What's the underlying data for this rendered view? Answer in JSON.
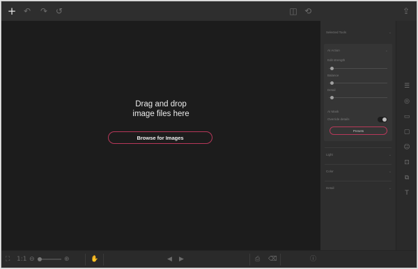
{
  "toolbar": {
    "left_icons": [
      "plus-icon",
      "undo-icon",
      "redo-icon",
      "reset-icon"
    ],
    "center_icons": [
      "compare-icon",
      "history-icon"
    ],
    "right_icons": [
      "share-icon"
    ],
    "glyphs": {
      "plus": "+",
      "undo": "↶",
      "redo": "↷",
      "reset": "↺",
      "compare": "◫",
      "history": "⟲",
      "share": "⇪"
    }
  },
  "canvas": {
    "drop_line1": "Drag and drop",
    "drop_line2": "image files here",
    "browse_label": "Browse for Images",
    "accent": "#b8385a"
  },
  "panel": {
    "section_title": "Selected Tools",
    "ai_action_label": "AI Action",
    "slider1_label": "Edit strength",
    "slider2_label": "Balance",
    "slider3_label": "Detail",
    "ai_mask_label": "AI Mask",
    "toggle_label": "Override details",
    "preset_button": "Presets",
    "light_label": "Light",
    "color_label": "Color",
    "detail_label": "Detail",
    "slider_values": [
      0.05,
      0.05,
      0.05
    ],
    "toggle_on": true
  },
  "bottombar": {
    "zoom_label": "1:1",
    "fit_icon": "⛶",
    "prev_glyph": "◀",
    "next_glyph": "▶"
  },
  "strip": {
    "icons": [
      "sliders-icon",
      "lens-icon",
      "monitor-icon",
      "chat-icon",
      "face-icon",
      "crop-icon",
      "layers-icon",
      "text-icon"
    ],
    "glyphs": [
      "☰",
      "◎",
      "▭",
      "▢",
      "☺",
      "⊡",
      "⧉",
      "T"
    ]
  }
}
